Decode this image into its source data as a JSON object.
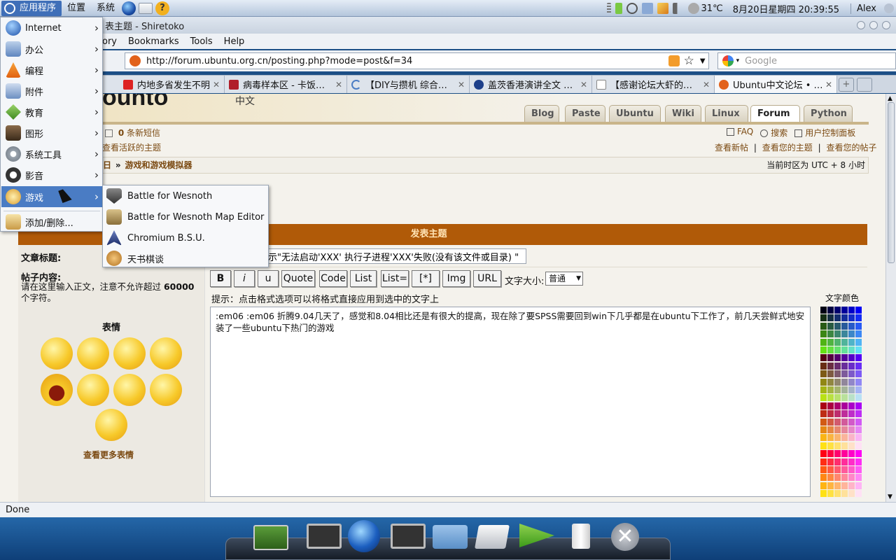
{
  "top_panel": {
    "applications": "应用程序",
    "places": "位置",
    "system": "系统",
    "temperature": "31℃",
    "datetime": "8月20日星期四 20:39:55",
    "user": "Alex"
  },
  "window": {
    "title": "发表主题 - Shiretoko",
    "title_visible": "表主题 - Shiretoko"
  },
  "browser_menu": {
    "history_partial": "ory",
    "bookmarks": "Bookmarks",
    "tools": "Tools",
    "help": "Help"
  },
  "nav": {
    "url": "http://forum.ubuntu.org.cn/posting.php?mode=post&f=34",
    "search_placeholder": "Google"
  },
  "tabs": [
    {
      "label": "内地多省发生不明…",
      "close": "✕"
    },
    {
      "label": "病毒样本区 - 卡饭…",
      "close": "✕"
    },
    {
      "label": "【DIY与攒机 综合…",
      "close": "✕"
    },
    {
      "label": "盖茨香港演讲全文 …",
      "close": "✕"
    },
    {
      "label": "【感谢论坛大虾的…",
      "close": "✕"
    },
    {
      "label": "Ubuntu中文论坛 • …",
      "close": "✕"
    }
  ],
  "site": {
    "logo_partial": "ounto",
    "logo_sub": "中文",
    "tabs": [
      "Blog",
      "Paste",
      "Ubuntu",
      "Wiki",
      "Linux",
      "Forum",
      "Python"
    ],
    "pm_count": "0",
    "pm_label": "条新短信",
    "active_topics": "查看活跃的主题",
    "faq": "FAQ",
    "search": "搜索",
    "ucp": "用户控制面板",
    "new_posts": "查看新帖",
    "your_topics": "查看您的主题",
    "your_posts": "查看您的帖子",
    "sep": "|",
    "breadcrumb_prefix": "日",
    "breadcrumb_arrow": "»",
    "breadcrumb": "游戏和游戏模拟器",
    "timezone": "当前时区为 UTC + 8 小时"
  },
  "post_form": {
    "header": "发表主题",
    "subject_label": "文章标题:",
    "subject_value": "示\"无法启动'XXX' 执行子进程'XXX'失败(没有该文件或目录) \"",
    "body_label": "帖子内容:",
    "body_hint_1": "请在这里输入正文，注意不允许超过 ",
    "body_hint_limit": "60000",
    "body_hint_2": " 个字符。",
    "smilies_title": "表情",
    "more_smilies": "查看更多表情",
    "buttons": [
      "B",
      "i",
      "u",
      "Quote",
      "Code",
      "List",
      "List=",
      "[*]",
      "Img",
      "URL"
    ],
    "font_size_label": "文字大小:",
    "font_size_value": "普通",
    "tip": "提示：点击格式选项可以将格式直接应用到选中的文字上",
    "font_color_label": "文字颜色",
    "body_text": " :em06  :em06 折腾9.04几天了，感觉和8.04相比还是有很大的提高，现在除了要SPSS需要回到win下几乎都是在ubuntu下工作了，前几天尝鲜式地安装了一些ubuntu下热门的游戏"
  },
  "statusbar": {
    "text": "Done"
  },
  "app_menu": {
    "items": [
      "Internet",
      "办公",
      "编程",
      "附件",
      "教育",
      "图形",
      "系统工具",
      "影音",
      "游戏"
    ],
    "add_remove": "添加/删除...",
    "arrow": "›"
  },
  "games_menu": [
    "Battle for Wesnoth",
    "Battle for Wesnoth Map Editor",
    "Chromium B.S.U.",
    "天书棋谈"
  ],
  "colors": {
    "accent": "#4a7cc4",
    "form_header": "#b05a08",
    "link": "#7b4a12",
    "panel": "#b5c6dc"
  }
}
